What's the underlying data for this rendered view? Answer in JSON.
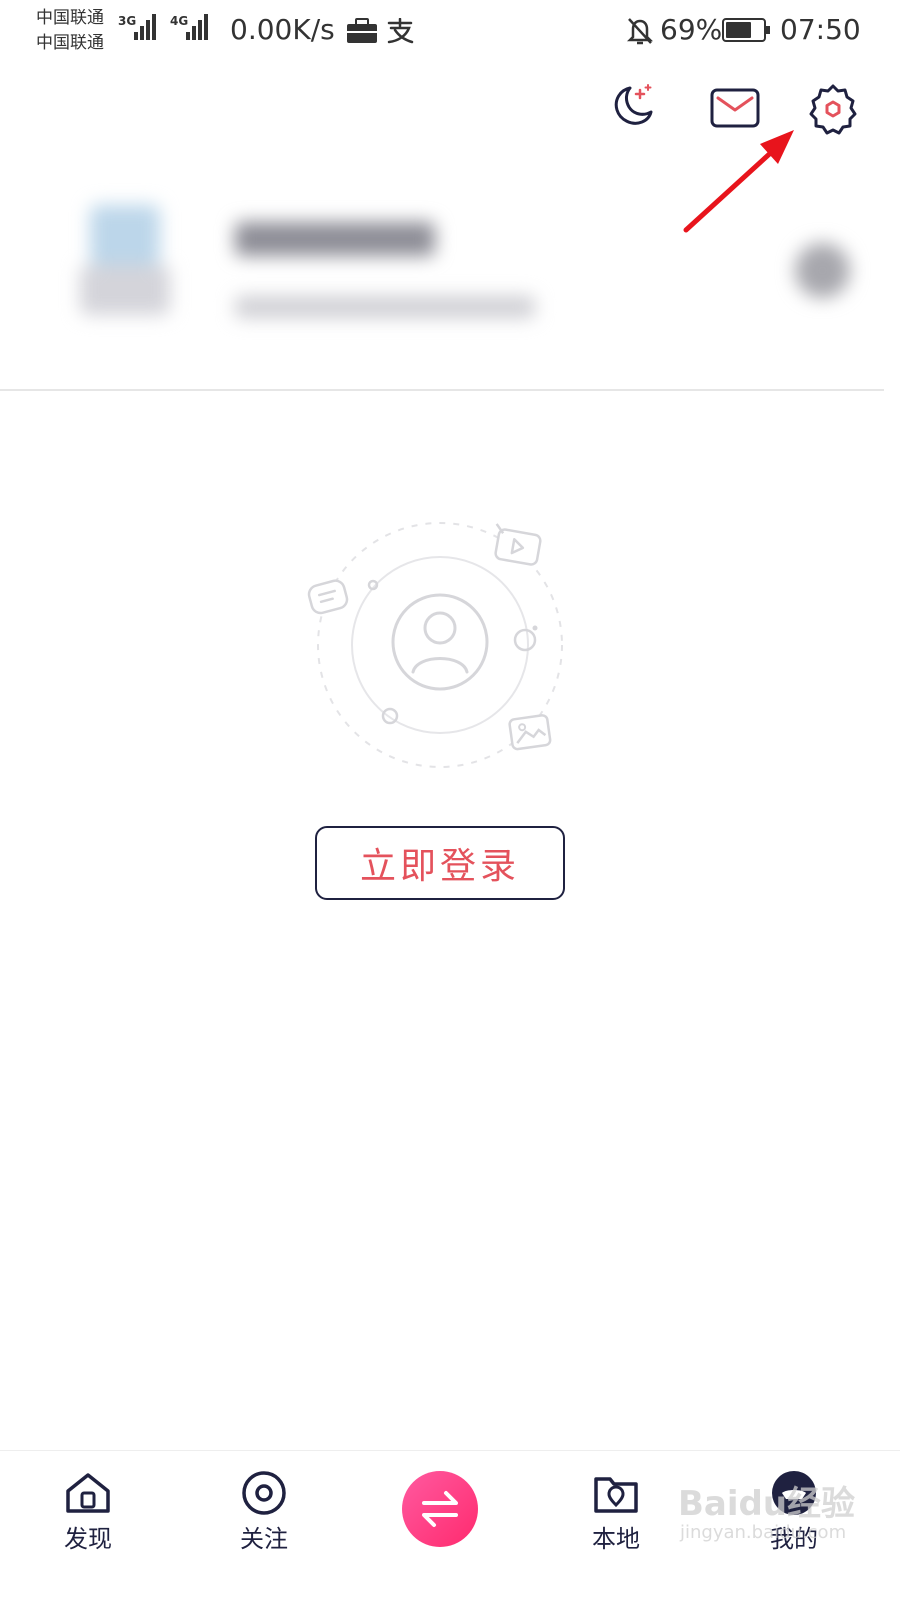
{
  "status_bar": {
    "carrier_1": "中国联通",
    "carrier_2": "中国联通",
    "net_1": "3G",
    "net_2": "4G",
    "speed": "0.00K/s",
    "battery_percent": "69%",
    "battery_level": 0.69,
    "time": "07:50",
    "icons": [
      "briefcase-icon",
      "alipay-icon",
      "bell-off-icon",
      "battery-icon"
    ]
  },
  "header_icons": [
    "night-mode-icon",
    "mail-icon",
    "settings-icon"
  ],
  "main": {
    "login_button": "立即登录"
  },
  "bottom_nav": {
    "items": [
      {
        "label": "发现",
        "icon": "home-icon"
      },
      {
        "label": "关注",
        "icon": "eye-icon"
      },
      {
        "label": "",
        "icon": "switch-icon"
      },
      {
        "label": "本地",
        "icon": "location-folder-icon"
      },
      {
        "label": "我的",
        "icon": "profile-icon"
      }
    ]
  },
  "watermark": {
    "brand": "Baidu经验",
    "url": "jingyan.baidu.com"
  },
  "colors": {
    "accent": "#e4525c",
    "nav_dark": "#1f2140",
    "switch_gradient_start": "#ff3d7f",
    "switch_gradient_end": "#ff2a8a",
    "annotation_arrow": "#e8141c"
  }
}
